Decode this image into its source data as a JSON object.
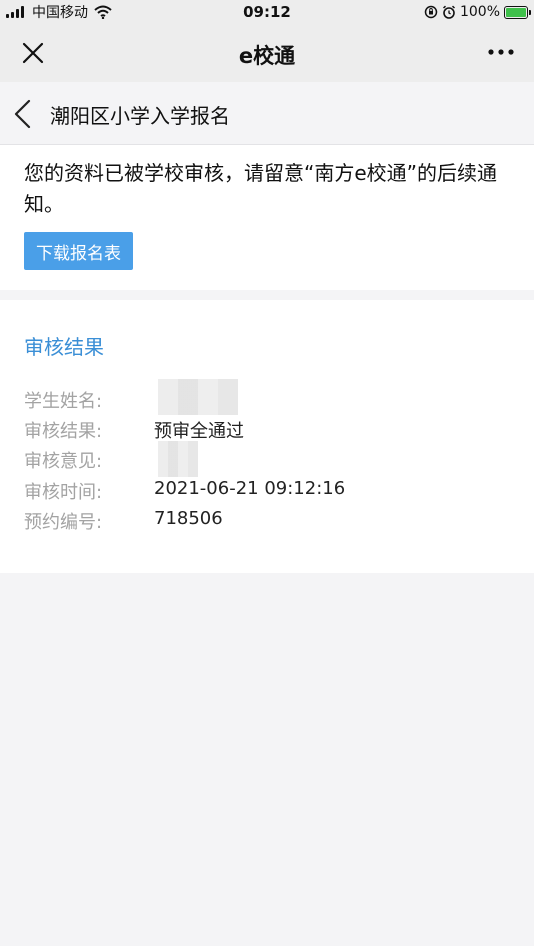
{
  "status_bar": {
    "carrier": "中国移动",
    "time": "09:12",
    "battery": "100%"
  },
  "nav": {
    "title": "e校通",
    "close_icon": "close-icon",
    "more_icon": "more-icon"
  },
  "subheader": {
    "title": "潮阳区小学入学报名",
    "back_icon": "chevron-left-icon"
  },
  "notice": {
    "text": "您的资料已被学校审核，请留意“南方e校通”的后续通知。",
    "download_button": "下载报名表"
  },
  "result": {
    "title": "审核结果",
    "rows": [
      {
        "label": "学生姓名:",
        "value": ""
      },
      {
        "label": "审核结果:",
        "value": "预审全通过"
      },
      {
        "label": "审核意见:",
        "value": ""
      },
      {
        "label": "审核时间:",
        "value": "2021-06-21 09:12:16"
      },
      {
        "label": "预约编号:",
        "value": "718506"
      }
    ]
  },
  "colors": {
    "accent": "#3b8fd6",
    "button": "#4a9fe8",
    "battery": "#3fc04b"
  }
}
